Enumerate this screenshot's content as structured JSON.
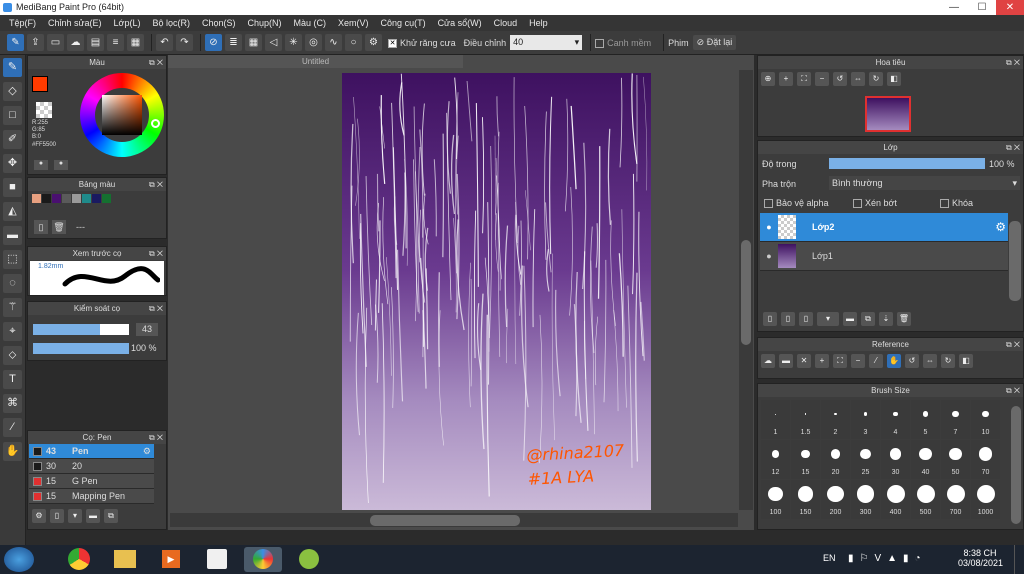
{
  "window": {
    "title": "MediBang Paint Pro (64bit)",
    "minimize": "—",
    "maximize": "☐",
    "close": "✕"
  },
  "menu": [
    "Tệp(F)",
    "Chỉnh sửa(E)",
    "Lớp(L)",
    "Bộ lọc(R)",
    "Chọn(S)",
    "Chụp(N)",
    "Màu (C)",
    "Xem(V)",
    "Công cụ(T)",
    "Cửa sổ(W)",
    "Cloud",
    "Help"
  ],
  "toolbar": {
    "antialias_label": "Khử răng cưa",
    "adjust_label": "Điều chỉnh",
    "adjust_value": "40",
    "canh_mem": "Canh mềm",
    "phim_label": "Phim",
    "reset_label": "Đặt lại"
  },
  "canvas": {
    "tab": "Untitled",
    "signature": "@rhina2107 #1A LYA"
  },
  "color_panel": {
    "title": "Màu",
    "rgb": "R:255\nG:85\nB:0",
    "hex": "#FF5500",
    "fg": "#ff3b00",
    "bg": "#5a2d82"
  },
  "palette_panel": {
    "title": "Bảng màu",
    "swatches": [
      "#e8a080",
      "#1a1a1a",
      "#4a1070",
      "#5a5a5a",
      "#9a9a9a",
      "#1f8a8a",
      "#1a1a60",
      "#157030"
    ],
    "name": "---"
  },
  "preview_panel": {
    "title": "Xem trước cọ",
    "size": "1.82mm"
  },
  "brush_control": {
    "title": "Kiểm soát cọ",
    "size": "43",
    "opacity": "100 %",
    "size_frac": 0.7,
    "opacity_frac": 1.0
  },
  "brushes": {
    "title": "Cọ: Pen",
    "items": [
      {
        "size": "43",
        "name": "Pen",
        "color": "#1a1a1a"
      },
      {
        "size": "30",
        "name": "20",
        "color": "#1a1a1a"
      },
      {
        "size": "15",
        "name": "G Pen",
        "color": "#e03030"
      },
      {
        "size": "15",
        "name": "Mapping Pen",
        "color": "#e03030"
      }
    ]
  },
  "navigator": {
    "title": "Hoa tiêu"
  },
  "layers": {
    "title": "Lớp",
    "opacity_label": "Độ trong",
    "opacity_value": "100 %",
    "opacity_frac": 1.0,
    "blend_label": "Pha trộn",
    "blend_value": "Bình thường",
    "protect_alpha": "Bảo vệ alpha",
    "clip": "Xén bớt",
    "lock": "Khóa",
    "items": [
      "Lớp2",
      "Lớp1"
    ]
  },
  "reference": {
    "title": "Reference"
  },
  "brush_size": {
    "title": "Brush Size",
    "sizes": [
      "1",
      "1.5",
      "2",
      "3",
      "4",
      "5",
      "7",
      "10",
      "12",
      "15",
      "20",
      "25",
      "30",
      "40",
      "50",
      "70",
      "100",
      "150",
      "200",
      "300",
      "400",
      "500",
      "700",
      "1000"
    ]
  },
  "taskbar": {
    "lang": "EN",
    "time": "8:38 CH",
    "date": "03/08/2021"
  }
}
